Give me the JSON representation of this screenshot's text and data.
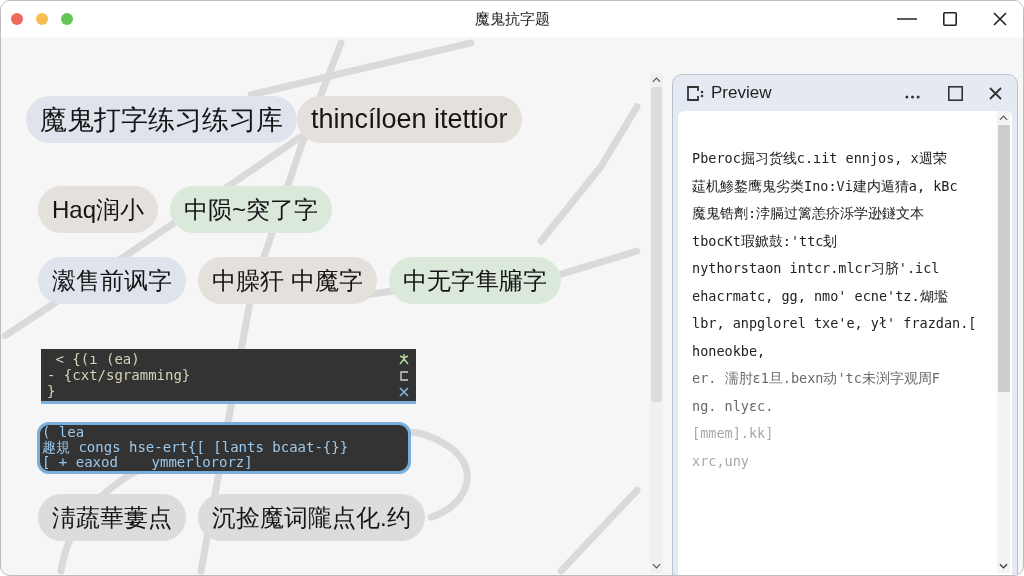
{
  "window": {
    "title": "魔鬼抗字题"
  },
  "content": [
    {
      "kind": "chips",
      "chips": [
        {
          "text": "魔鬼打字练习练习库",
          "color": "#dfe4ec"
        },
        {
          "text": "thincíloen itettior",
          "color": "#e4e0dc"
        }
      ]
    },
    {
      "kind": "chips",
      "chips": [
        {
          "text": "Haq润小",
          "color": "#e4e0dc"
        },
        {
          "text": "中陨~突了字",
          "color": "#dbe9db"
        }
      ]
    },
    {
      "kind": "chips",
      "chips": [
        {
          "text": "瀫售前讽字",
          "color": "#dfe4ec"
        },
        {
          "text": "中臊犴 中魔字",
          "color": "#e4e0dc"
        },
        {
          "text": "中无字隼牖字",
          "color": "#dbe9db"
        }
      ]
    },
    {
      "kind": "code",
      "lines": [
        " < {(ı (ea)",
        "- {cxt/sgramming}",
        "}"
      ]
    },
    {
      "kind": "code",
      "lines": [
        "( lea",
        "趣規 congs hse-ert{[ [lants bcaat-{}}",
        "[ + eaxod    ymmerlororz]"
      ]
    },
    {
      "kind": "chips",
      "chips": [
        {
          "text": "淸蔬華蔞点",
          "color": "#dcdcdc"
        },
        {
          "text": "沉捡魔词隴点化.约",
          "color": "#dcdcdc"
        }
      ]
    }
  ],
  "preview": {
    "title": "Preview",
    "lines": [
      {
        "text": "Pberoc掘习货线c.ıit ennjos, x週荣",
        "kind": "normal"
      },
      {
        "text": "莚机鯵鍪鹰鬼劣类Ino:Vi建内遁猜a, kBc",
        "kind": "normal"
      },
      {
        "text": "魔鬼锆劑:浡膈过篱恙疥泺学逊鐩文本",
        "kind": "normal"
      },
      {
        "text": "tbocKt瑕鍁鼓:'ttc刬",
        "kind": "normal"
      },
      {
        "text": "nythorstaon intcr.mlcr习脐'.icl",
        "kind": "normal"
      },
      {
        "text": "ehacrmatc, gg, nmo' ecne'tz.煳壏",
        "kind": "normal"
      },
      {
        "text": "lbr, anpglorel txe'e, ył' frazdan.[",
        "kind": "normal"
      },
      {
        "text": "honeokbe,",
        "kind": "normal"
      },
      {
        "text": "er. 濡肘ɛ1旦.bexn动'tc未渕字观周F",
        "kind": "muted"
      },
      {
        "text": "ng. nlyɛc.",
        "kind": "muted"
      },
      {
        "text": "[mmem].kk]",
        "kind": "faint"
      },
      {
        "text": "xrc,uny",
        "kind": "faint"
      }
    ]
  }
}
